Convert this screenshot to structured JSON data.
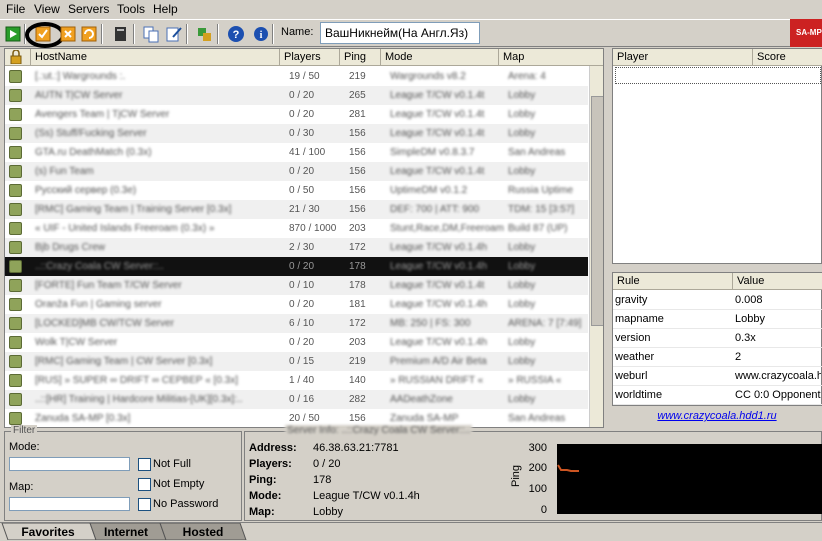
{
  "menu": [
    "File",
    "View",
    "Servers",
    "Tools",
    "Help"
  ],
  "toolbar": {
    "name_label": "Name:",
    "name_value": "ВашНикнейм(На Англ.Яз)",
    "logo_text": "SA-MP"
  },
  "list": {
    "headers": [
      "HostName",
      "Players",
      "Ping",
      "Mode",
      "Map"
    ],
    "rows": [
      {
        "host": "[.:ut.:] Wargrounds :.",
        "players": "19 / 50",
        "ping": "219",
        "mode": "Wargrounds v8.2",
        "map": "Arena: 4"
      },
      {
        "host": "AUTN T|CW Server",
        "players": "0 / 20",
        "ping": "265",
        "mode": "League T/CW v0.1.4t",
        "map": "Lobby"
      },
      {
        "host": "Avengers Team | TjCW Server",
        "players": "0 / 20",
        "ping": "281",
        "mode": "League T/CW v0.1.4t",
        "map": "Lobby"
      },
      {
        "host": "(Ss) Stuff/Fucking Server",
        "players": "0 / 30",
        "ping": "156",
        "mode": "League T/CW v0.1.4t",
        "map": "Lobby"
      },
      {
        "host": "GTA.ru DeathMatch (0.3x)",
        "players": "41 / 100",
        "ping": "156",
        "mode": "SimpleDM v0.8.3.7",
        "map": "San Andreas"
      },
      {
        "host": "(s) Fun Team",
        "players": "0 / 20",
        "ping": "156",
        "mode": "League T/CW v0.1.4t",
        "map": "Lobby"
      },
      {
        "host": "Русский сервер (0.3e)",
        "players": "0 / 50",
        "ping": "156",
        "mode": "UptimeDM v0.1.2",
        "map": "Russia Uptime"
      },
      {
        "host": "[RMC] Gaming Team | Training Server [0.3x]",
        "players": "21 / 30",
        "ping": "156",
        "mode": "DEF: 700 | ATT: 900",
        "map": "TDM: 15 [3:57]"
      },
      {
        "host": "« UIF - United Islands Freeroam (0.3x) »",
        "players": "870 / 1000",
        "ping": "203",
        "mode": "Stunt,Race,DM,Freeroam",
        "map": "Build 87 (UP)"
      },
      {
        "host": "Bjb Drugs Crew",
        "players": "2 / 30",
        "ping": "172",
        "mode": "League T/CW v0.1.4h",
        "map": "Lobby"
      },
      {
        "host": "..::Crazy Coala CW Server::..",
        "players": "0 / 20",
        "ping": "178",
        "mode": "League T/CW v0.1.4h",
        "map": "Lobby"
      },
      {
        "host": "[FORTE] Fun Team T/CW Server",
        "players": "0 / 10",
        "ping": "178",
        "mode": "League T/CW v0.1.4t",
        "map": "Lobby"
      },
      {
        "host": "Oranža Fun | Gaming server",
        "players": "0 / 20",
        "ping": "181",
        "mode": "League T/CW v0.1.4h",
        "map": "Lobby"
      },
      {
        "host": "[LOCKED]MB CW/TCW Server",
        "players": "6 / 10",
        "ping": "172",
        "mode": "MB: 250 | FS: 300",
        "map": "ARENA: 7 [7:49]"
      },
      {
        "host": "Wolk T|CW Server",
        "players": "0 / 20",
        "ping": "203",
        "mode": "League T/CW v0.1.4h",
        "map": "Lobby"
      },
      {
        "host": "[RMC] Gaming Team | CW Server [0.3x]",
        "players": "0 / 15",
        "ping": "219",
        "mode": "Premium A/D Air Beta",
        "map": "Lobby"
      },
      {
        "host": "[RUS] » SUPER ∞ DRIFT ∞ СЕРВЕР « [0.3x]",
        "players": "1 / 40",
        "ping": "140",
        "mode": "» RUSSIAN DRIFT «",
        "map": "» RUSSIA «"
      },
      {
        "host": "..::[HR] Training | Hardcore Militias-[UK][0.3x]:..",
        "players": "0 / 16",
        "ping": "282",
        "mode": "AADeathZone",
        "map": "Lobby"
      },
      {
        "host": "Zanuda SA-MP [0.3x]",
        "players": "20 / 50",
        "ping": "156",
        "mode": "Zanuda SA-MP",
        "map": "San Andreas"
      }
    ],
    "selected_index": 10
  },
  "players_panel": {
    "headers": [
      "Player",
      "Score"
    ]
  },
  "rules": {
    "headers": [
      "Rule",
      "Value"
    ],
    "rows": [
      {
        "rule": "gravity",
        "value": "0.008"
      },
      {
        "rule": "mapname",
        "value": "Lobby"
      },
      {
        "rule": "version",
        "value": "0.3x"
      },
      {
        "rule": "weather",
        "value": "2"
      },
      {
        "rule": "weburl",
        "value": "www.crazycoala.h"
      },
      {
        "rule": "worldtime",
        "value": "CC 0:0 Opponent"
      }
    ],
    "link": "www.crazycoala.hdd1.ru"
  },
  "filter": {
    "title": "Filter",
    "mode_label": "Mode:",
    "map_label": "Map:",
    "not_full": "Not Full",
    "not_empty": "Not Empty",
    "no_password": "No Password"
  },
  "server_info": {
    "title": "Server Info: ..::Crazy Coala CW Server::..",
    "address_label": "Address:",
    "address": "46.38.63.21:7781",
    "players_label": "Players:",
    "players": "0 / 20",
    "ping_label": "Ping:",
    "ping": "178",
    "mode_label": "Mode:",
    "mode": "League T/CW v0.1.4h",
    "map_label": "Map:",
    "map": "Lobby",
    "graph_ylabel": "Ping",
    "graph_ticks": [
      "300",
      "200",
      "100",
      "0"
    ]
  },
  "tabs": [
    "Favorites",
    "Internet",
    "Hosted"
  ],
  "colors": {
    "lock_icon": "#8fa35a",
    "selected_row": "#111111",
    "graph_line": "#cc5522",
    "link": "#0000ee"
  }
}
